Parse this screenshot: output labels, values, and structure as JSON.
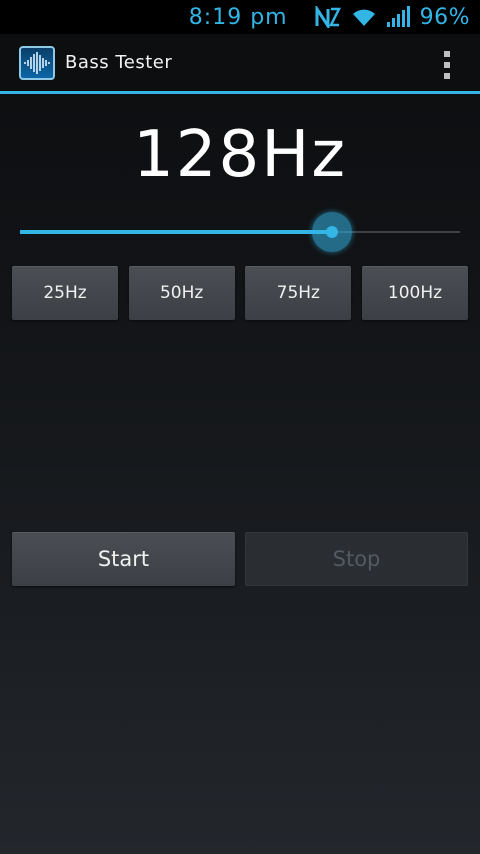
{
  "status_bar": {
    "time": "8:19 pm",
    "battery": "96%",
    "icons": [
      "nfc-icon",
      "wifi-icon",
      "signal-icon"
    ]
  },
  "action_bar": {
    "title": "Bass Tester",
    "app_icon": "waveform-icon",
    "overflow_icon": "overflow-menu-icon"
  },
  "frequency": {
    "display": "128Hz"
  },
  "slider": {
    "fraction": 0.71
  },
  "presets": [
    {
      "label": "25Hz"
    },
    {
      "label": "50Hz"
    },
    {
      "label": "75Hz"
    },
    {
      "label": "100Hz"
    }
  ],
  "controls": {
    "start_label": "Start",
    "stop_label": "Stop",
    "stop_enabled": false
  },
  "colors": {
    "accent": "#33b5e5",
    "background": "#121417",
    "button": "#44484d"
  }
}
